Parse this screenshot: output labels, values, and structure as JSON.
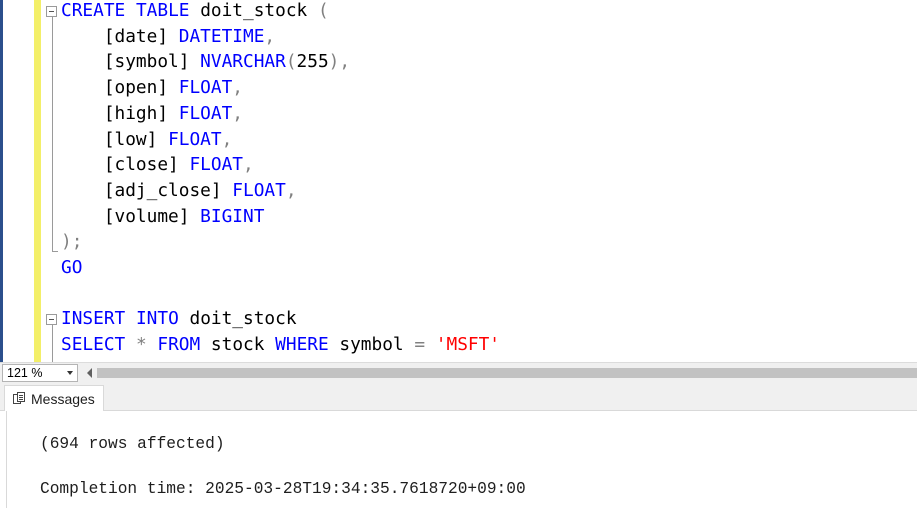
{
  "editor": {
    "lines": [
      {
        "tokens": [
          {
            "t": "CREATE",
            "c": "kw"
          },
          {
            "t": " "
          },
          {
            "t": "TABLE",
            "c": "kw"
          },
          {
            "t": " doit_stock "
          },
          {
            "t": "(",
            "c": "pun"
          }
        ]
      },
      {
        "tokens": [
          {
            "t": "    [date] "
          },
          {
            "t": "DATETIME",
            "c": "kw"
          },
          {
            "t": ",",
            "c": "pun"
          }
        ]
      },
      {
        "tokens": [
          {
            "t": "    [symbol] "
          },
          {
            "t": "NVARCHAR",
            "c": "kw"
          },
          {
            "t": "(",
            "c": "pun"
          },
          {
            "t": "255"
          },
          {
            "t": "),",
            "c": "pun"
          }
        ]
      },
      {
        "tokens": [
          {
            "t": "    [open] "
          },
          {
            "t": "FLOAT",
            "c": "kw"
          },
          {
            "t": ",",
            "c": "pun"
          }
        ]
      },
      {
        "tokens": [
          {
            "t": "    [high] "
          },
          {
            "t": "FLOAT",
            "c": "kw"
          },
          {
            "t": ",",
            "c": "pun"
          }
        ]
      },
      {
        "tokens": [
          {
            "t": "    [low] "
          },
          {
            "t": "FLOAT",
            "c": "kw"
          },
          {
            "t": ",",
            "c": "pun"
          }
        ]
      },
      {
        "tokens": [
          {
            "t": "    [close] "
          },
          {
            "t": "FLOAT",
            "c": "kw"
          },
          {
            "t": ",",
            "c": "pun"
          }
        ]
      },
      {
        "tokens": [
          {
            "t": "    [adj_close] "
          },
          {
            "t": "FLOAT",
            "c": "kw"
          },
          {
            "t": ",",
            "c": "pun"
          }
        ]
      },
      {
        "tokens": [
          {
            "t": "    [volume] "
          },
          {
            "t": "BIGINT",
            "c": "kw"
          }
        ]
      },
      {
        "tokens": [
          {
            "t": ");",
            "c": "pun"
          }
        ]
      },
      {
        "tokens": [
          {
            "t": "GO",
            "c": "kw"
          }
        ]
      },
      {
        "tokens": []
      },
      {
        "tokens": [
          {
            "t": "INSERT",
            "c": "kw"
          },
          {
            "t": " "
          },
          {
            "t": "INTO",
            "c": "kw"
          },
          {
            "t": " doit_stock"
          }
        ]
      },
      {
        "tokens": [
          {
            "t": "SELECT",
            "c": "kw"
          },
          {
            "t": " "
          },
          {
            "t": "*",
            "c": "pun"
          },
          {
            "t": " "
          },
          {
            "t": "FROM",
            "c": "kw"
          },
          {
            "t": " stock "
          },
          {
            "t": "WHERE",
            "c": "kw"
          },
          {
            "t": " symbol "
          },
          {
            "t": "=",
            "c": "pun"
          },
          {
            "t": " "
          },
          {
            "t": "'MSFT'",
            "c": "str"
          }
        ]
      }
    ]
  },
  "status": {
    "zoom": "121 %"
  },
  "results": {
    "tab_label": "Messages",
    "messages": [
      "(694 rows affected)",
      "Completion time: 2025-03-28T19:34:35.7618720+09:00"
    ]
  },
  "colors": {
    "keyword": "#0000ff",
    "punctuation": "#808080",
    "string": "#ff0000",
    "margin_bar": "#f3ef68"
  },
  "icons": {
    "collapse": "collapse-minus-icon",
    "zoom_dropdown": "chevron-down-icon",
    "scroll_left": "scroll-left-arrow-icon",
    "messages": "messages-icon"
  }
}
